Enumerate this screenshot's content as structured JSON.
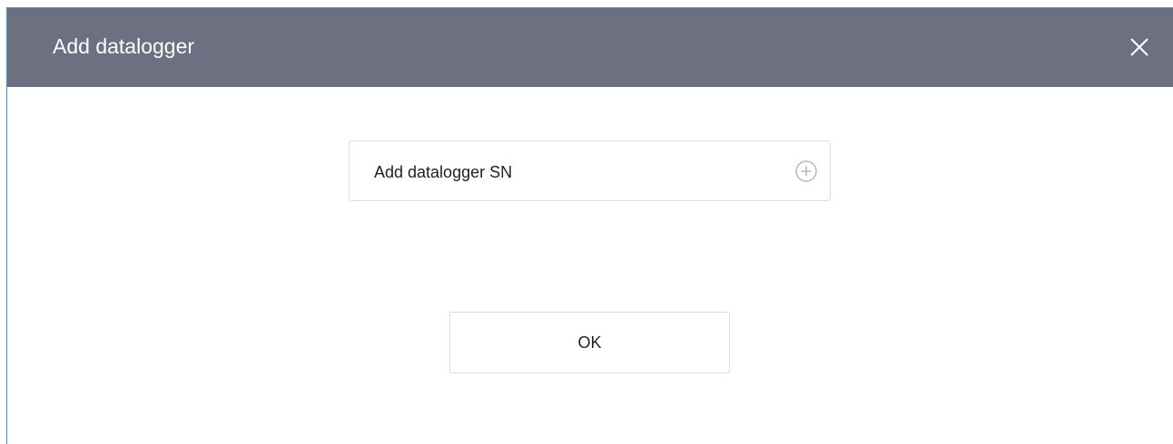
{
  "dialog": {
    "title": "Add datalogger",
    "close_icon": "close-icon"
  },
  "sn_field": {
    "label": "Add datalogger SN",
    "icon": "plus-circle-icon"
  },
  "actions": {
    "ok_label": "OK"
  },
  "colors": {
    "header_bg": "#6d7080",
    "border_accent": "#2f9ad6",
    "field_border": "#dcdcdc"
  }
}
